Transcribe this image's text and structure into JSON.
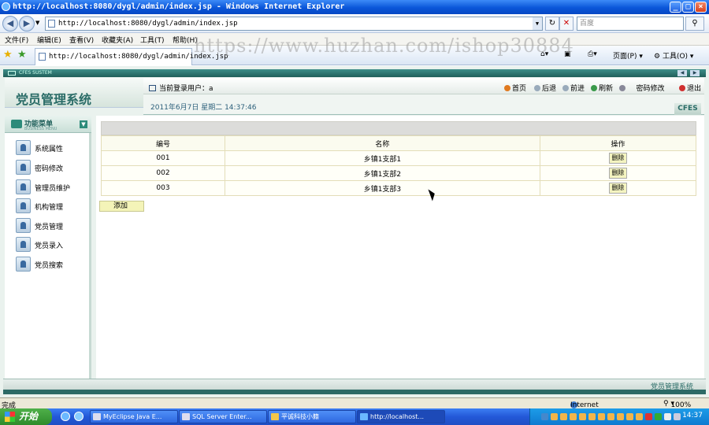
{
  "browser": {
    "title": "http://localhost:8080/dygl/admin/index.jsp - Windows Internet Explorer",
    "address": "http://localhost:8080/dygl/admin/index.jsp",
    "search_placeholder": "百度",
    "menu": [
      "文件(F)",
      "编辑(E)",
      "查看(V)",
      "收藏夹(A)",
      "工具(T)",
      "帮助(H)"
    ],
    "tab_title": "http://localhost:8080/dygl/admin/index.jsp",
    "tab_tools": {
      "page": "页面(P)",
      "tools": "工具(O)"
    },
    "watermark": "https://www.huzhan.com/ishop30884",
    "status_left": "完成",
    "status_zone": "Internet",
    "zoom": "100%"
  },
  "app": {
    "header_small": "CFES SUSTEM",
    "brand": "党员管理系统",
    "user_label": "当前登录用户：a",
    "date": "2011年6月7日  星期二  14:37:46",
    "logo_tag": "CFES",
    "nav": {
      "home": "首页",
      "back": "后退",
      "forward": "前进",
      "refresh": "刷新",
      "password": "密码修改",
      "logout": "退出"
    },
    "sidebar": {
      "title": "功能菜单",
      "subtitle": "BUSINESS MENU",
      "items": [
        "系统属性",
        "密码修改",
        "管理员维护",
        "机构管理",
        "党员管理",
        "党员录入",
        "党员搜索"
      ]
    },
    "table": {
      "headers": [
        "编号",
        "名称",
        "操作"
      ],
      "rows": [
        {
          "id": "001",
          "name": "乡镇1支部1",
          "action": "删除"
        },
        {
          "id": "002",
          "name": "乡镇1支部2",
          "action": "删除"
        },
        {
          "id": "003",
          "name": "乡镇1支部3",
          "action": "删除"
        }
      ]
    },
    "add_label": "添加",
    "footer": "党员管理系统"
  },
  "taskbar": {
    "start": "开始",
    "tasks": [
      "MyEclipse Java E...",
      "SQL Server Enter...",
      "平诚科技小籍",
      "http://localhost..."
    ],
    "clock": "14:37"
  }
}
